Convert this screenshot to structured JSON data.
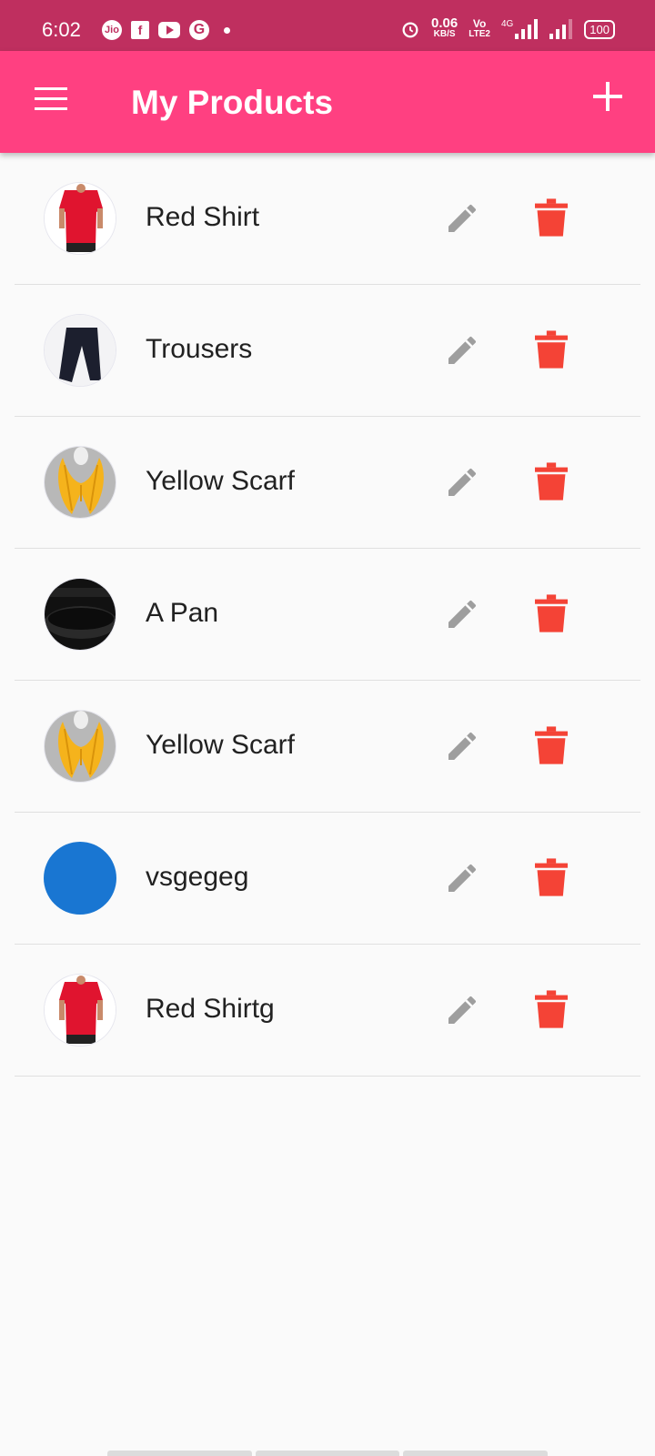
{
  "status_bar": {
    "time": "6:02",
    "carrier_badge": "Jio",
    "facebook_badge": "f",
    "google_badge": "G",
    "speed_value": "0.06",
    "speed_unit": "KB/S",
    "volte_top": "Vo",
    "volte_bottom": "LTE2",
    "network_type": "4G",
    "battery": "100"
  },
  "app_bar": {
    "title": "My Products"
  },
  "products": [
    {
      "name": "Red Shirt",
      "image": "red-shirt"
    },
    {
      "name": "Trousers",
      "image": "trousers"
    },
    {
      "name": "Yellow Scarf",
      "image": "yellow-scarf"
    },
    {
      "name": "A Pan",
      "image": "pan"
    },
    {
      "name": "Yellow Scarf",
      "image": "yellow-scarf"
    },
    {
      "name": "vsgegeg",
      "image": "blue-circle"
    },
    {
      "name": "Red Shirtg",
      "image": "red-shirt"
    }
  ],
  "colors": {
    "status_bar": "#bf2f5f",
    "app_bar": "#ff4081",
    "edit_icon": "#9e9e9e",
    "delete_icon": "#f44336",
    "placeholder_avatar": "#1976d2"
  }
}
